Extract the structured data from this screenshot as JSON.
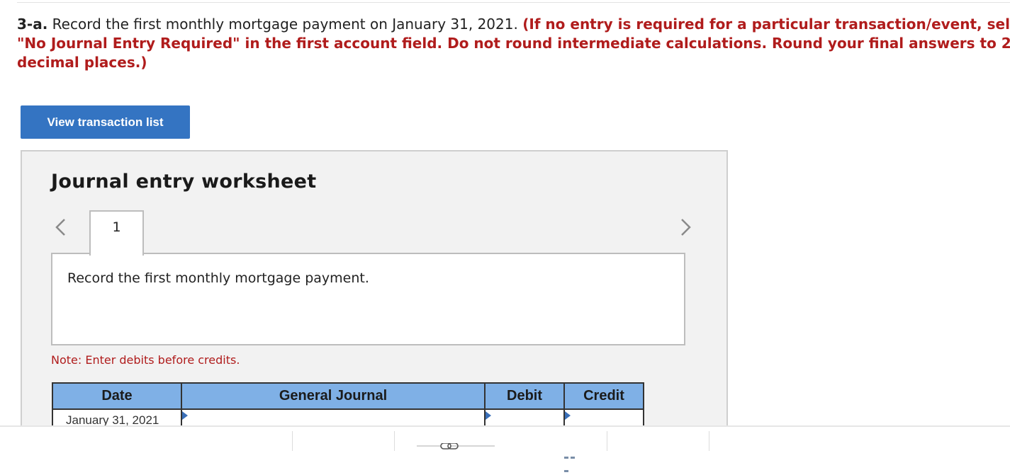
{
  "question": {
    "number": "3-a.",
    "prompt": " Record the first monthly mortgage payment on January 31, 2021. ",
    "instructions_line1": "(If no entry is required for a particular transaction/event, select",
    "instructions_line2": "\"No Journal Entry Required\" in the first account field. Do not round intermediate calculations. Round your final answers to 2",
    "instructions_line3": "decimal places.)"
  },
  "view_transactions_label": "View transaction list",
  "worksheet": {
    "title": "Journal entry worksheet",
    "tab_number": "1",
    "description": "Record the first monthly mortgage payment.",
    "note": "Note: Enter debits before credits.",
    "columns": {
      "date": "Date",
      "journal": "General Journal",
      "debit": "Debit",
      "credit": "Credit"
    },
    "rows": [
      {
        "date": "January 31, 2021",
        "account": "",
        "debit": "",
        "credit": ""
      }
    ]
  },
  "colors": {
    "accent_red": "#b01c1c",
    "button_blue": "#3474c2",
    "header_blue": "#7fb0e6"
  },
  "icons": [
    "chevron-left-icon",
    "chevron-right-icon",
    "link-icon",
    "grid-icon"
  ]
}
